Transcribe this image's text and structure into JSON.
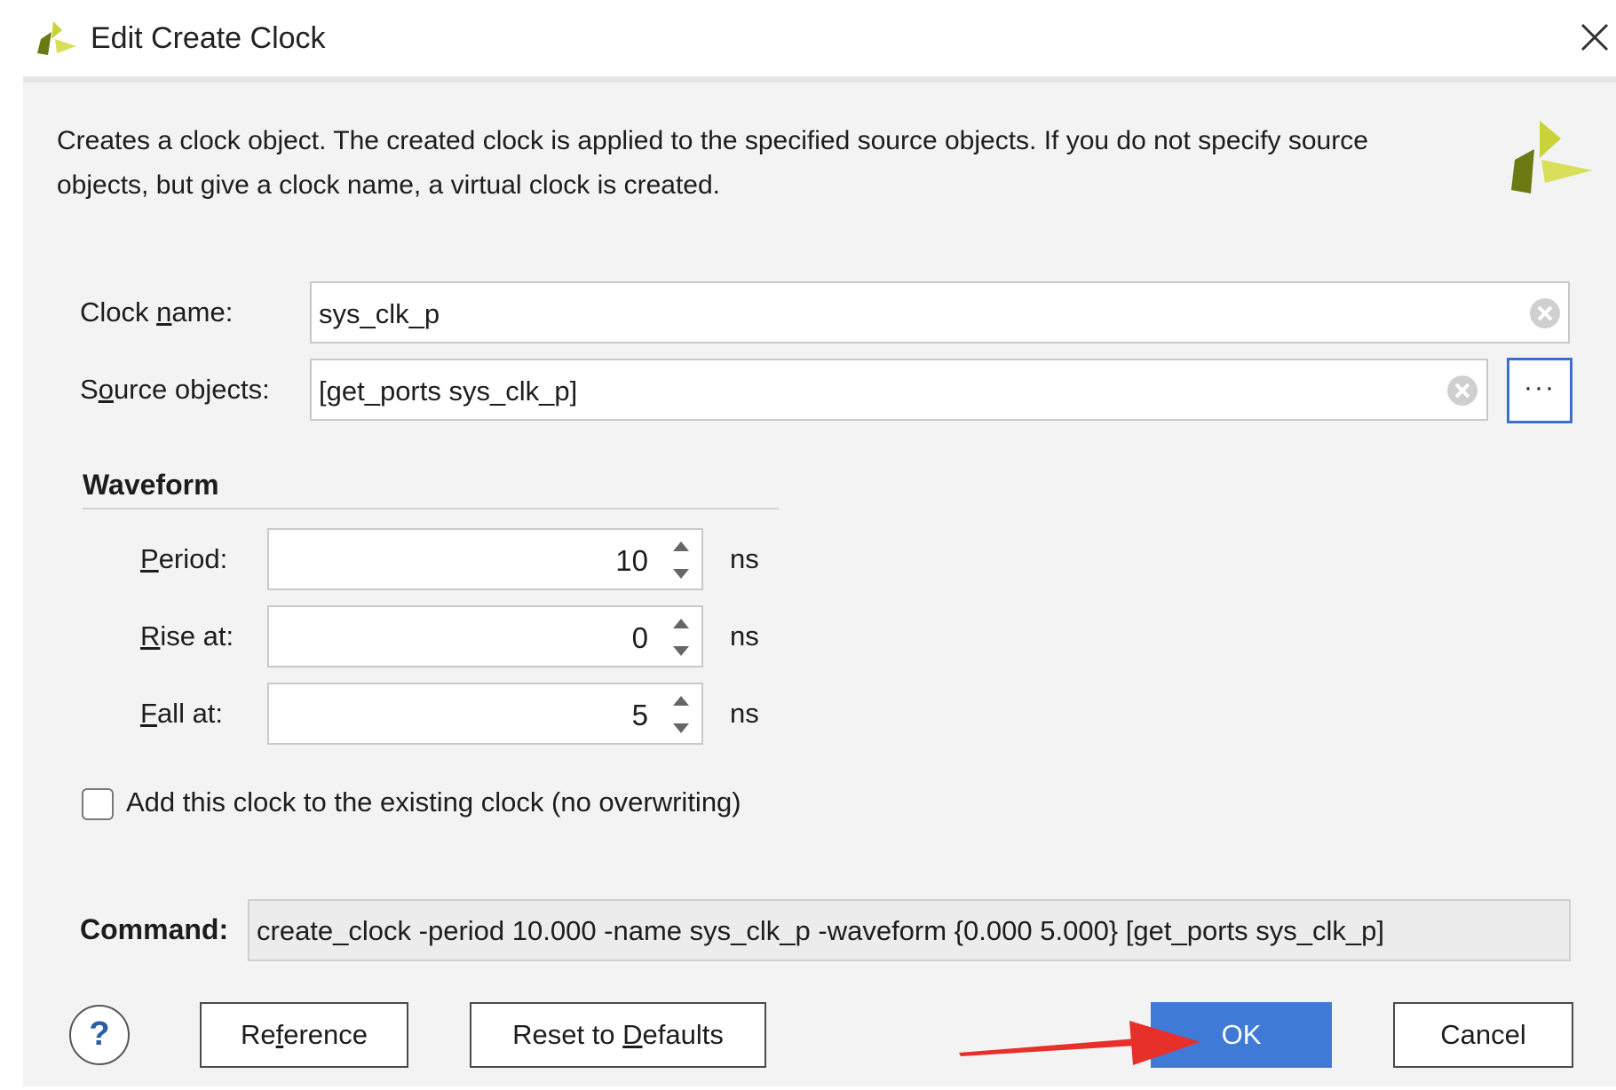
{
  "window": {
    "title": "Edit Create Clock",
    "close_icon": "close-icon",
    "logo_icon": "vivado-logo-icon"
  },
  "description": "Creates a clock object. The created clock is applied to the specified source objects. If you do not specify source objects, but give a clock name, a virtual clock is created.",
  "form": {
    "clock_name": {
      "label": "Clock name:",
      "value": "sys_clk_p",
      "clear_icon": "clear-icon"
    },
    "source_objects": {
      "label": "Source objects:",
      "value": "[get_ports sys_clk_p]",
      "clear_icon": "clear-icon",
      "browse_label": "···"
    }
  },
  "waveform": {
    "title": "Waveform",
    "period": {
      "label": "Period:",
      "value": "10",
      "unit": "ns"
    },
    "rise_at": {
      "label": "Rise at:",
      "value": "0",
      "unit": "ns"
    },
    "fall_at": {
      "label": "Fall at:",
      "value": "5",
      "unit": "ns"
    }
  },
  "add_clock_checkbox": {
    "label": "Add this clock to the existing clock (no overwriting)",
    "checked": false
  },
  "command": {
    "label": "Command:",
    "value": "create_clock -period 10.000 -name sys_clk_p -waveform {0.000 5.000} [get_ports sys_clk_p]"
  },
  "buttons": {
    "help": "?",
    "reference": "Reference",
    "reset": "Reset to Defaults",
    "ok": "OK",
    "cancel": "Cancel"
  },
  "colors": {
    "accent": "#3f7ad6",
    "annotation_arrow": "#e8302a",
    "dialog_bg": "#f3f3f3"
  }
}
